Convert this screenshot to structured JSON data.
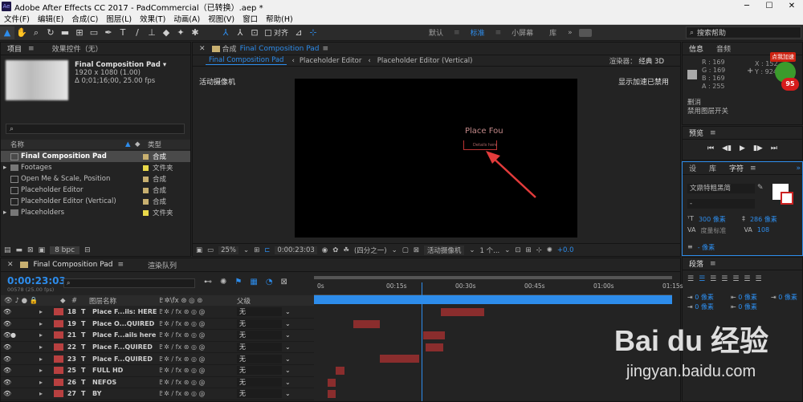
{
  "window": {
    "title": "Adobe After Effects CC 2017 - PadCommercial（已转换）.aep *",
    "logo": "Ae"
  },
  "menu": [
    "文件(F)",
    "编辑(E)",
    "合成(C)",
    "图层(L)",
    "效果(T)",
    "动画(A)",
    "视图(V)",
    "窗口",
    "帮助(H)"
  ],
  "toolbar": {
    "snap_label": "对齐",
    "workspaces": [
      "默认",
      "标准",
      "小屏幕",
      "库"
    ],
    "active_workspace": "标准",
    "search_placeholder": "搜索帮助"
  },
  "project": {
    "tab_project": "项目",
    "tab_effects": "效果控件（无）",
    "comp_name": "Final Composition Pad ▾",
    "comp_info1": "1920 x 1080 (1.00)",
    "comp_info2": "Δ 0;01;16;00, 25.00 fps",
    "search_placeholder": "",
    "col_name": "名称",
    "col_type": "类型",
    "bpc": "8 bpc",
    "items": [
      {
        "name": "Final Composition Pad",
        "type": "合成",
        "kind": "comp",
        "color": "#c8b070",
        "selected": true
      },
      {
        "name": "Footages",
        "type": "文件夹",
        "kind": "folder",
        "color": "#e8d84a",
        "selected": false
      },
      {
        "name": "Open Me & Scale, Position",
        "type": "合成",
        "kind": "comp",
        "color": "#c8b070",
        "selected": false
      },
      {
        "name": "Placeholder Editor",
        "type": "合成",
        "kind": "comp",
        "color": "#c8b070",
        "selected": false
      },
      {
        "name": "Placeholder Editor (Vertical)",
        "type": "合成",
        "kind": "comp",
        "color": "#c8b070",
        "selected": false
      },
      {
        "name": "Placeholders",
        "type": "文件夹",
        "kind": "folder",
        "color": "#e8d84a",
        "selected": false
      }
    ]
  },
  "comp": {
    "tab_label": "合成",
    "tab_name": "Final Composition Pad",
    "tabs": [
      "Final Composition Pad",
      "Placeholder Editor",
      "Placeholder Editor (Vertical)"
    ],
    "renderer_label": "渲染器：",
    "renderer": "经典 3D",
    "camera_label": "活动摄像机",
    "accel_label": "显示加速已禁用",
    "placeholder_text": "Place Fou",
    "placeholder_sub": "Details here",
    "zoom": "25%",
    "timecode": "0:00:23:03",
    "resolution": "(四分之一)",
    "view_camera": "活动摄像机",
    "views": "1 个...",
    "exposure": "+0.0"
  },
  "info": {
    "tab_info": "信息",
    "tab_audio": "音频",
    "r": "R : 169",
    "g": "G : 169",
    "b": "B : 169",
    "a": "A : 255",
    "x": "X : 152",
    "y": "Y : 924",
    "msg1": "删消",
    "msg2": "禁用图层开关",
    "badge_top": "点我加速",
    "badge_num": "95"
  },
  "preview": {
    "title": "预览"
  },
  "character": {
    "tabs": [
      "设",
      "库",
      "字符"
    ],
    "font": "文鼎特粗黑简",
    "style": "-",
    "size": "300 像素",
    "leading": "286 像素",
    "kerning": "度量标准",
    "tracking": "108",
    "stroke": "- 像素"
  },
  "paragraph": {
    "title": "段落",
    "v1": "0 像素",
    "v2": "0 像素",
    "v3": "0 像素",
    "v4": "0 像素",
    "v5": "0 像素"
  },
  "timeline": {
    "tab_comp": "Final Composition Pad",
    "tab_render": "渲染队列",
    "timecode": "0:00:23:03",
    "frames": "00578 (25.00 fps)",
    "col_name": "图层名称",
    "col_parent": "父级",
    "ruler": [
      "0s",
      "00:15s",
      "00:30s",
      "00:45s",
      "01:00s",
      "01:15s"
    ],
    "playhead": 0.3,
    "layers": [
      {
        "num": "18",
        "name": "Place F...ils: HERE",
        "parent": "无",
        "start": 0.354,
        "end": 0.476
      },
      {
        "num": "19",
        "name": "Place O...QUIRED",
        "parent": "无",
        "start": 0.11,
        "end": 0.183
      },
      {
        "num": "21",
        "name": "Place F...ails here",
        "parent": "无",
        "start": 0.305,
        "end": 0.366
      },
      {
        "num": "22",
        "name": "Place F...QUIRED",
        "parent": "无",
        "start": 0.311,
        "end": 0.36
      },
      {
        "num": "23",
        "name": "Place F...QUIRED",
        "parent": "无",
        "start": 0.183,
        "end": 0.293
      },
      {
        "num": "25",
        "name": "FULL HD",
        "parent": "无",
        "start": 0.061,
        "end": 0.085
      },
      {
        "num": "26",
        "name": "NEFOS",
        "parent": "无",
        "start": 0.037,
        "end": 0.061
      },
      {
        "num": "27",
        "name": "BY",
        "parent": "无",
        "start": 0.037,
        "end": 0.061
      }
    ]
  },
  "watermark": {
    "brand": "Bai du 经验",
    "url": "jingyan.baidu.com"
  }
}
